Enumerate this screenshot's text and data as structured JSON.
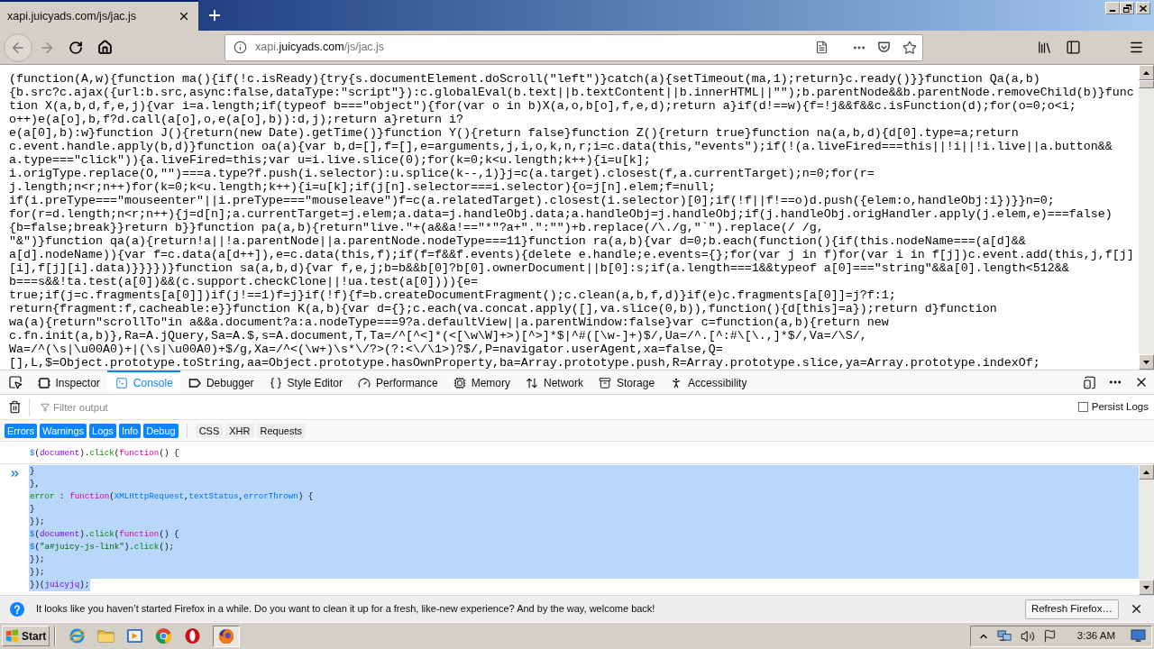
{
  "tabs": [
    {
      "title": "xapi.juicyads.com/js/jac.js",
      "selected": true
    }
  ],
  "url_bar": {
    "subdomain": "xapi.",
    "domain": "juicyads.com",
    "path": "/js/jac.js"
  },
  "source": {
    "lines": [
      "(function(A,w){function ma(){if(!c.isReady){try{s.documentElement.doScroll(\"left\")}catch(a){setTimeout(ma,1);return}c.ready()}}function Qa(a,b)",
      "{b.src?c.ajax({url:b.src,async:false,dataType:\"script\"}):c.globalEval(b.text||b.textContent||b.innerHTML||\"\");b.parentNode&&b.parentNode.removeChild(b)}func",
      "tion X(a,b,d,f,e,j){var i=a.length;if(typeof b===\"object\"){for(var o in b)X(a,o,b[o],f,e,d);return a}if(d!==w){f=!j&&f&&c.isFunction(d);for(o=0;o<i;",
      "o++)e(a[o],b,f?d.call(a[o],o,e(a[o],b)):d,j);return a}return i?",
      "e(a[0],b):w}function J(){return(new Date).getTime()}function Y(){return false}function Z(){return true}function na(a,b,d){d[0].type=a;return",
      "c.event.handle.apply(b,d)}function oa(a){var b,d=[],f=[],e=arguments,j,i,o,k,n,r;i=c.data(this,\"events\");if(!(a.liveFired===this||!i||!i.live||a.button&&",
      "a.type===\"click\")){a.liveFired=this;var u=i.live.slice(0);for(k=0;k<u.length;k++){i=u[k];",
      "i.origType.replace(O,\"\")===a.type?f.push(i.selector):u.splice(k--,1)}j=c(a.target).closest(f,a.currentTarget);n=0;for(r=",
      "j.length;n<r;n++)for(k=0;k<u.length;k++){i=u[k];if(j[n].selector===i.selector){o=j[n].elem;f=null;",
      "if(i.preType===\"mouseenter\"||i.preType===\"mouseleave\")f=c(a.relatedTarget).closest(i.selector)[0];if(!f||f!==o)d.push({elem:o,handleObj:i})}}n=0;",
      "for(r=d.length;n<r;n++){j=d[n];a.currentTarget=j.elem;a.data=j.handleObj.data;a.handleObj=j.handleObj;if(j.handleObj.origHandler.apply(j.elem,e)===false)",
      "{b=false;break}}return b}}function pa(a,b){return\"live.\"+(a&&a!==\"*\"?a+\".\":\"\")+b.replace(/\\./g,\"`\").replace(/ /g,",
      "\"&\")}function qa(a){return!a||!a.parentNode||a.parentNode.nodeType===11}function ra(a,b){var d=0;b.each(function(){if(this.nodeName===(a[d]&&",
      "a[d].nodeName)){var f=c.data(a[d++]),e=c.data(this,f);if(f=f&&f.events){delete e.handle;e.events={};for(var j in f)for(var i in f[j])c.event.add(this,j,f[j]",
      "[i],f[j][i].data)}}}})}function sa(a,b,d){var f,e,j;b=b&&b[0]?b[0].ownerDocument||b[0]:s;if(a.length===1&&typeof a[0]===\"string\"&&a[0].length<512&&",
      "b===s&&!ta.test(a[0])&&(c.support.checkClone||!ua.test(a[0]))){e=",
      "true;if(j=c.fragments[a[0]])if(j!==1)f=j}if(!f){f=b.createDocumentFragment();c.clean(a,b,f,d)}if(e)c.fragments[a[0]]=j?f:1;",
      "return{fragment:f,cacheable:e}}function K(a,b){var d={};c.each(va.concat.apply([],va.slice(0,b)),function(){d[this]=a});return d}function",
      "wa(a){return\"scrollTo\"in a&&a.document?a:a.nodeType===9?a.defaultView||a.parentWindow:false}var c=function(a,b){return new",
      "c.fn.init(a,b)},Ra=A.jQuery,Sa=A.$,s=A.document,T,Ta=/^[^<]*(<[\\w\\W]+>)[^>]*$|^#([\\w-]+)$/,Ua=/^.[^:#\\[\\.,]*$/,Va=/\\S/,",
      "Wa=/^(\\s|\\u00A0)+|(\\s|\\u00A0)+$/g,Xa=/^<(\\w+)\\s*\\/?>(?:<\\/\\1>)?$/,P=navigator.userAgent,xa=false,Q=",
      "[],L,$=Object.prototype.toString,aa=Object.prototype.hasOwnProperty,ba=Array.prototype.push,R=Array.prototype.slice,ya=Array.prototype.indexOf;"
    ]
  },
  "devtools": {
    "tabs": [
      {
        "label": "Inspector",
        "selected": false
      },
      {
        "label": "Console",
        "selected": true
      },
      {
        "label": "Debugger",
        "selected": false
      },
      {
        "label": "Style Editor",
        "selected": false
      },
      {
        "label": "Performance",
        "selected": false
      },
      {
        "label": "Memory",
        "selected": false
      },
      {
        "label": "Network",
        "selected": false
      },
      {
        "label": "Storage",
        "selected": false
      },
      {
        "label": "Accessibility",
        "selected": false
      }
    ],
    "filter": {
      "placeholder": "Filter output"
    },
    "persist_logs": {
      "label": "Persist Logs",
      "checked": false
    },
    "log_levels": [
      {
        "label": "Errors",
        "selected": true
      },
      {
        "label": "Warnings",
        "selected": true
      },
      {
        "label": "Logs",
        "selected": true
      },
      {
        "label": "Info",
        "selected": true
      },
      {
        "label": "Debug",
        "selected": true
      }
    ],
    "message_types": [
      {
        "label": "CSS",
        "selected": false
      },
      {
        "label": "XHR",
        "selected": false
      },
      {
        "label": "Requests",
        "selected": false
      }
    ]
  },
  "console": {
    "output": [
      [
        {
          "text": "$",
          "kind": "def"
        },
        {
          "text": "(",
          "kind": "plain"
        },
        {
          "text": "document",
          "kind": "variable"
        },
        {
          "text": ").",
          "kind": "plain"
        },
        {
          "text": "click",
          "kind": "property"
        },
        {
          "text": "(",
          "kind": "plain"
        },
        {
          "text": "function",
          "kind": "keyword"
        },
        {
          "text": "() {",
          "kind": "plain"
        }
      ]
    ],
    "input": {
      "selected": true,
      "lines": [
        [
          {
            "text": "}",
            "kind": "plain"
          }
        ],
        [
          {
            "text": "},",
            "kind": "plain"
          }
        ],
        [
          {
            "text": "error",
            "kind": "property"
          },
          {
            "text": " : ",
            "kind": "plain"
          },
          {
            "text": "function",
            "kind": "keyword"
          },
          {
            "text": "(",
            "kind": "plain"
          },
          {
            "text": "XMLHttpRequest",
            "kind": "def"
          },
          {
            "text": ",",
            "kind": "plain"
          },
          {
            "text": "textStatus",
            "kind": "def"
          },
          {
            "text": ",",
            "kind": "plain"
          },
          {
            "text": "errorThrown",
            "kind": "def"
          },
          {
            "text": ") {",
            "kind": "plain"
          }
        ],
        [
          {
            "text": "}",
            "kind": "plain"
          }
        ],
        [
          {
            "text": "});",
            "kind": "plain"
          }
        ],
        [
          {
            "text": "$",
            "kind": "def"
          },
          {
            "text": "(",
            "kind": "plain"
          },
          {
            "text": "document",
            "kind": "variable"
          },
          {
            "text": ").",
            "kind": "plain"
          },
          {
            "text": "click",
            "kind": "property"
          },
          {
            "text": "(",
            "kind": "plain"
          },
          {
            "text": "function",
            "kind": "keyword"
          },
          {
            "text": "() {",
            "kind": "plain"
          }
        ],
        [
          {
            "text": "$",
            "kind": "def"
          },
          {
            "text": "(",
            "kind": "plain"
          },
          {
            "text": "\"a#juicy-js-link\"",
            "kind": "string"
          },
          {
            "text": ").",
            "kind": "plain"
          },
          {
            "text": "click",
            "kind": "property"
          },
          {
            "text": "();",
            "kind": "plain"
          }
        ],
        [
          {
            "text": "});",
            "kind": "plain"
          }
        ],
        [
          {
            "text": "});",
            "kind": "plain"
          }
        ],
        [
          {
            "text": "})(",
            "kind": "plain"
          },
          {
            "text": "juicyjq",
            "kind": "variable"
          },
          {
            "text": ");",
            "kind": "plain"
          }
        ]
      ]
    }
  },
  "notification": {
    "text": "It looks like you haven’t started Firefox in a while. Do you want to clean it up for a fresh, like-new experience? And by the way, welcome back!",
    "button": "Refresh Firefox…"
  },
  "taskbar": {
    "start": "Start",
    "clock": "3:36 AM"
  }
}
